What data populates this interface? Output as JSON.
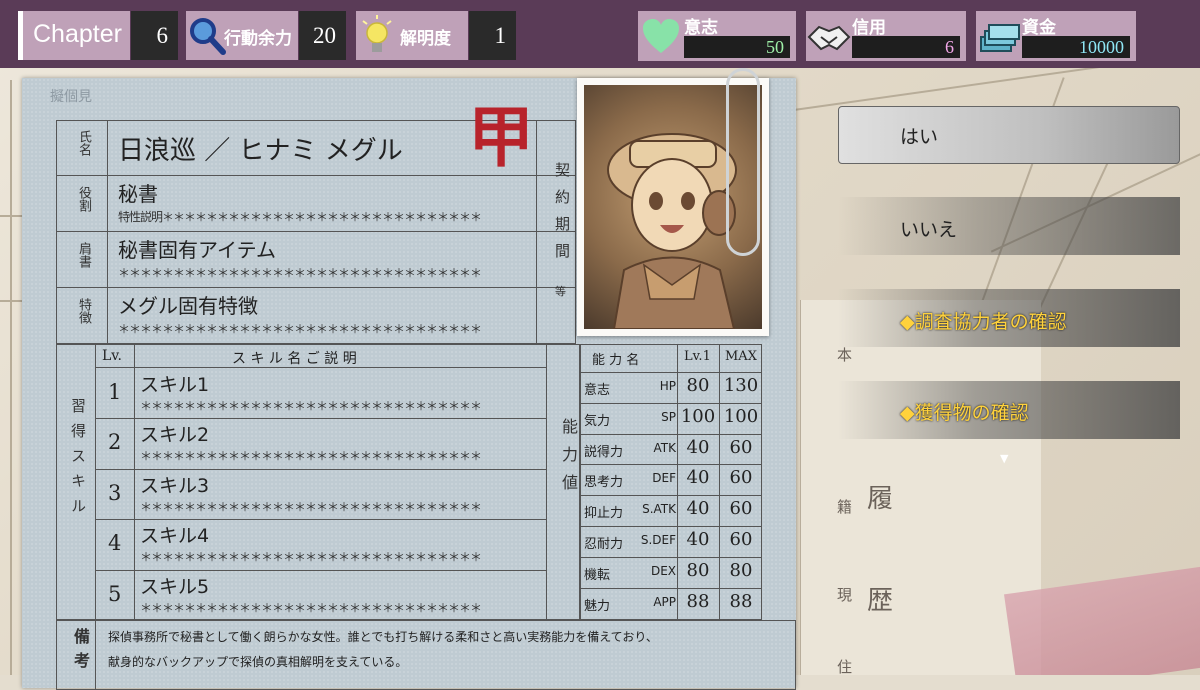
{
  "topbar": {
    "chapter_label": "Chapter",
    "chapter_value": "6",
    "action_label": "行動余力",
    "action_value": "20",
    "clarity_label": "解明度",
    "clarity_value": "1",
    "will_label": "意志",
    "will_value": "50",
    "trust_label": "信用",
    "trust_value": "6",
    "funds_label": "資金",
    "funds_value": "10000",
    "icons": [
      "magnifier-icon",
      "lightbulb-icon",
      "heart-icon",
      "handshake-icon",
      "money-icon"
    ]
  },
  "sheet": {
    "corner_note": "擬個見",
    "name_label": "氏名",
    "name_value": "日浪巡 ／ ヒナミ メグル",
    "stamp": "甲",
    "role_label": "役割",
    "role_value": "秘書",
    "role_sub": "特性説明＊＊＊＊＊＊＊＊＊＊＊＊＊＊＊＊＊＊＊＊＊＊＊＊＊＊＊＊＊",
    "title_label": "肩書",
    "title_value": "秘書固有アイテム",
    "title_sub": "＊＊＊＊＊＊＊＊＊＊＊＊＊＊＊＊＊＊＊＊＊＊＊＊＊＊＊＊＊＊＊＊＊",
    "trait_label": "特徴",
    "trait_value": "メグル固有特徴",
    "trait_sub": "＊＊＊＊＊＊＊＊＊＊＊＊＊＊＊＊＊＊＊＊＊＊＊＊＊＊＊＊＊＊＊＊＊",
    "contract_label": "契約期間",
    "contract_small": "等",
    "skills_side_label": "習得スキル",
    "skills_lv_header": "Lv.",
    "skills_header": "ス キ ル 名 ご 説 明",
    "skills": [
      {
        "lv": "1",
        "name": "スキル1",
        "desc": "＊＊＊＊＊＊＊＊＊＊＊＊＊＊＊＊＊＊＊＊＊＊＊＊＊＊＊＊＊＊＊"
      },
      {
        "lv": "2",
        "name": "スキル2",
        "desc": "＊＊＊＊＊＊＊＊＊＊＊＊＊＊＊＊＊＊＊＊＊＊＊＊＊＊＊＊＊＊＊"
      },
      {
        "lv": "3",
        "name": "スキル3",
        "desc": "＊＊＊＊＊＊＊＊＊＊＊＊＊＊＊＊＊＊＊＊＊＊＊＊＊＊＊＊＊＊＊"
      },
      {
        "lv": "4",
        "name": "スキル4",
        "desc": "＊＊＊＊＊＊＊＊＊＊＊＊＊＊＊＊＊＊＊＊＊＊＊＊＊＊＊＊＊＊＊"
      },
      {
        "lv": "5",
        "name": "スキル5",
        "desc": "＊＊＊＊＊＊＊＊＊＊＊＊＊＊＊＊＊＊＊＊＊＊＊＊＊＊＊＊＊＊＊"
      }
    ],
    "ability_side_label": "能力値",
    "ability_headers": [
      "能 力 名",
      "Lv.1",
      "MAX"
    ],
    "abilities": [
      {
        "jp": "意志",
        "code": "HP",
        "lv1": "80",
        "max": "130"
      },
      {
        "jp": "気力",
        "code": "SP",
        "lv1": "100",
        "max": "100"
      },
      {
        "jp": "説得力",
        "code": "ATK",
        "lv1": "40",
        "max": "60"
      },
      {
        "jp": "思考力",
        "code": "DEF",
        "lv1": "40",
        "max": "60"
      },
      {
        "jp": "抑止力",
        "code": "S.ATK",
        "lv1": "40",
        "max": "60"
      },
      {
        "jp": "忍耐力",
        "code": "S.DEF",
        "lv1": "40",
        "max": "60"
      },
      {
        "jp": "機転",
        "code": "DEX",
        "lv1": "80",
        "max": "80"
      },
      {
        "jp": "魅力",
        "code": "APP",
        "lv1": "88",
        "max": "88"
      }
    ],
    "remarks_label": "備考",
    "remarks_line1": "探偵事務所で秘書として働く朗らかな女性。誰とでも打ち解ける柔和さと高い実務能力を備えており、",
    "remarks_line2": "献身的なバックアップで探偵の真相解明を支えている。"
  },
  "menu": {
    "yes": "はい",
    "no": "いいえ",
    "check_allies": "◆調査協力者の確認",
    "check_items": "◆獲得物の確認",
    "more_indicator": "▼"
  },
  "background": {
    "doc_labels": [
      "本",
      "籍",
      "現",
      "住"
    ],
    "doc_title": [
      "履",
      "歴"
    ]
  },
  "colors": {
    "topbar": "#5a3b57",
    "chip_label": "#bfa1b8",
    "value_box": "#2a2a2a",
    "will_number": "#9ff0a8",
    "trust_number": "#f2a7e8",
    "funds_number": "#8fe7f5",
    "menu_highlight": "#ffd23c",
    "stamp_red": "#b8232b",
    "paper": "#bfcbd2"
  }
}
